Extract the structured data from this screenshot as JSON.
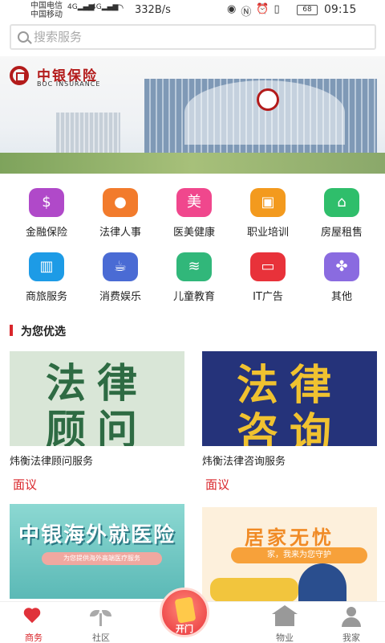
{
  "status_bar": {
    "carrier1": "中国电信",
    "carrier2": "中国移动",
    "signal1": "4G",
    "signal2": "4G",
    "speed": "332B/s",
    "battery": "68",
    "time": "09:15"
  },
  "search": {
    "placeholder": "搜索服务"
  },
  "banner": {
    "brand_cn": "中银保险",
    "brand_en": "BOC INSURANCE"
  },
  "categories": [
    {
      "label": "金融保险",
      "icon": "piggy-bank-icon",
      "color": "#b049c9"
    },
    {
      "label": "法律人事",
      "icon": "person-icon",
      "color": "#f27b2c"
    },
    {
      "label": "医美健康",
      "icon": "beauty-icon",
      "color": "#f0478d",
      "glyph": "美"
    },
    {
      "label": "职业培训",
      "icon": "training-icon",
      "color": "#f39a1e"
    },
    {
      "label": "房屋租售",
      "icon": "house-icon",
      "color": "#2fbe6b"
    },
    {
      "label": "商旅服务",
      "icon": "luggage-icon",
      "color": "#1d9be6"
    },
    {
      "label": "消费娱乐",
      "icon": "coffee-cup-icon",
      "color": "#4a6bd4"
    },
    {
      "label": "儿童教育",
      "icon": "layers-icon",
      "color": "#31b77a"
    },
    {
      "label": "IT广告",
      "icon": "monitor-icon",
      "color": "#e8323a"
    },
    {
      "label": "其他",
      "icon": "four-petal-icon",
      "color": "#8a6be0"
    }
  ],
  "section": {
    "title": "为您优选"
  },
  "products": [
    {
      "title": "炜衡法律顾问服务",
      "price": "面议",
      "image_text_1": "法律",
      "image_text_2": "顾问"
    },
    {
      "title": "炜衡法律咨询服务",
      "price": "面议",
      "image_text_1": "法律",
      "image_text_2": "咨询"
    },
    {
      "title": "",
      "price": "",
      "image_text_1": "中银海外就医险",
      "image_text_2": "为您提供海外高端医疗服务"
    },
    {
      "title": "",
      "price": "",
      "image_text_1": "居家无忧",
      "image_text_2": "家，我来为您守护"
    }
  ],
  "tabbar": {
    "tabs": [
      {
        "label": "商务",
        "icon": "heart-icon"
      },
      {
        "label": "社区",
        "icon": "sprout-icon"
      },
      {
        "label": "物业",
        "icon": "house-icon"
      },
      {
        "label": "我家",
        "icon": "user-icon"
      }
    ],
    "center_label": "开门"
  }
}
